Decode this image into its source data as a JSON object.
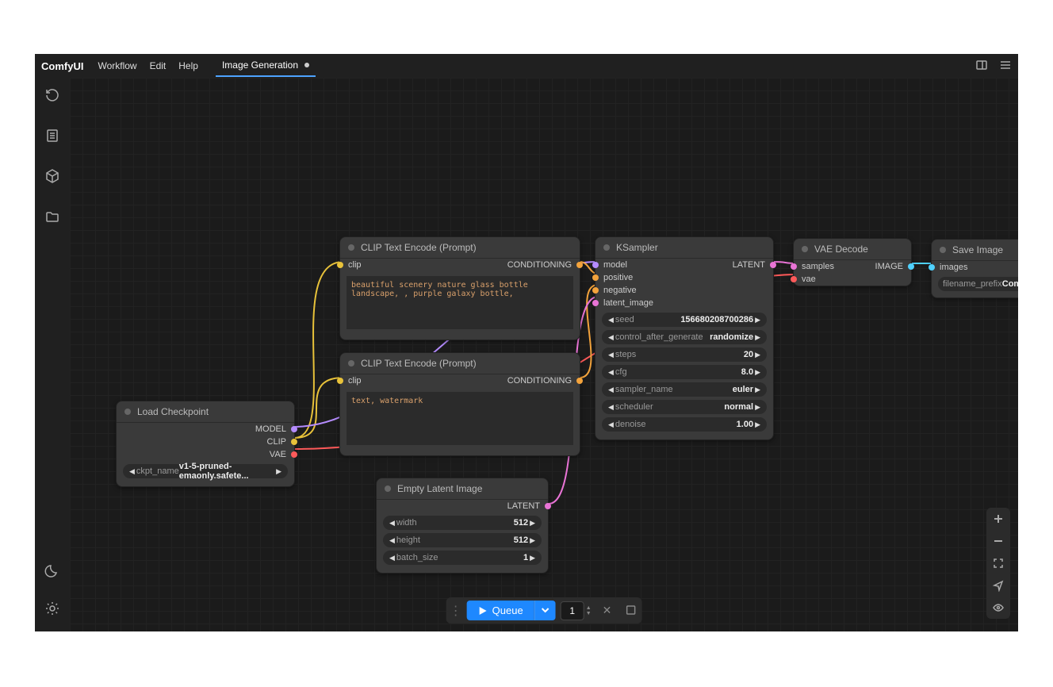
{
  "app": {
    "name": "ComfyUI"
  },
  "menu": {
    "workflow": "Workflow",
    "edit": "Edit",
    "help": "Help"
  },
  "tab": {
    "label": "Image Generation"
  },
  "nodes": {
    "load_ckpt": {
      "title": "Load Checkpoint",
      "outputs": {
        "model": "MODEL",
        "clip": "CLIP",
        "vae": "VAE"
      },
      "widgets": {
        "ckpt_name_label": "ckpt_name",
        "ckpt_name_value": "v1-5-pruned-emaonly.safete..."
      }
    },
    "clip_pos": {
      "title": "CLIP Text Encode (Prompt)",
      "inputs": {
        "clip": "clip"
      },
      "outputs": {
        "cond": "CONDITIONING"
      },
      "text": "beautiful scenery nature glass bottle landscape, , purple galaxy bottle,"
    },
    "clip_neg": {
      "title": "CLIP Text Encode (Prompt)",
      "inputs": {
        "clip": "clip"
      },
      "outputs": {
        "cond": "CONDITIONING"
      },
      "text": "text, watermark"
    },
    "latent": {
      "title": "Empty Latent Image",
      "outputs": {
        "latent": "LATENT"
      },
      "widgets": {
        "width_l": "width",
        "width_v": "512",
        "height_l": "height",
        "height_v": "512",
        "batch_l": "batch_size",
        "batch_v": "1"
      }
    },
    "ksampler": {
      "title": "KSampler",
      "inputs": {
        "model": "model",
        "positive": "positive",
        "negative": "negative",
        "latent_image": "latent_image"
      },
      "outputs": {
        "latent": "LATENT"
      },
      "widgets": {
        "seed_l": "seed",
        "seed_v": "156680208700286",
        "ctrl_l": "control_after_generate",
        "ctrl_v": "randomize",
        "steps_l": "steps",
        "steps_v": "20",
        "cfg_l": "cfg",
        "cfg_v": "8.0",
        "sampler_l": "sampler_name",
        "sampler_v": "euler",
        "sched_l": "scheduler",
        "sched_v": "normal",
        "denoise_l": "denoise",
        "denoise_v": "1.00"
      }
    },
    "vae": {
      "title": "VAE Decode",
      "inputs": {
        "samples": "samples",
        "vae": "vae"
      },
      "outputs": {
        "image": "IMAGE"
      }
    },
    "save": {
      "title": "Save Image",
      "inputs": {
        "images": "images"
      },
      "widgets": {
        "prefix_l": "filename_prefix",
        "prefix_v": "ComfyUI"
      }
    }
  },
  "bottombar": {
    "queue": "Queue",
    "count": "1"
  }
}
